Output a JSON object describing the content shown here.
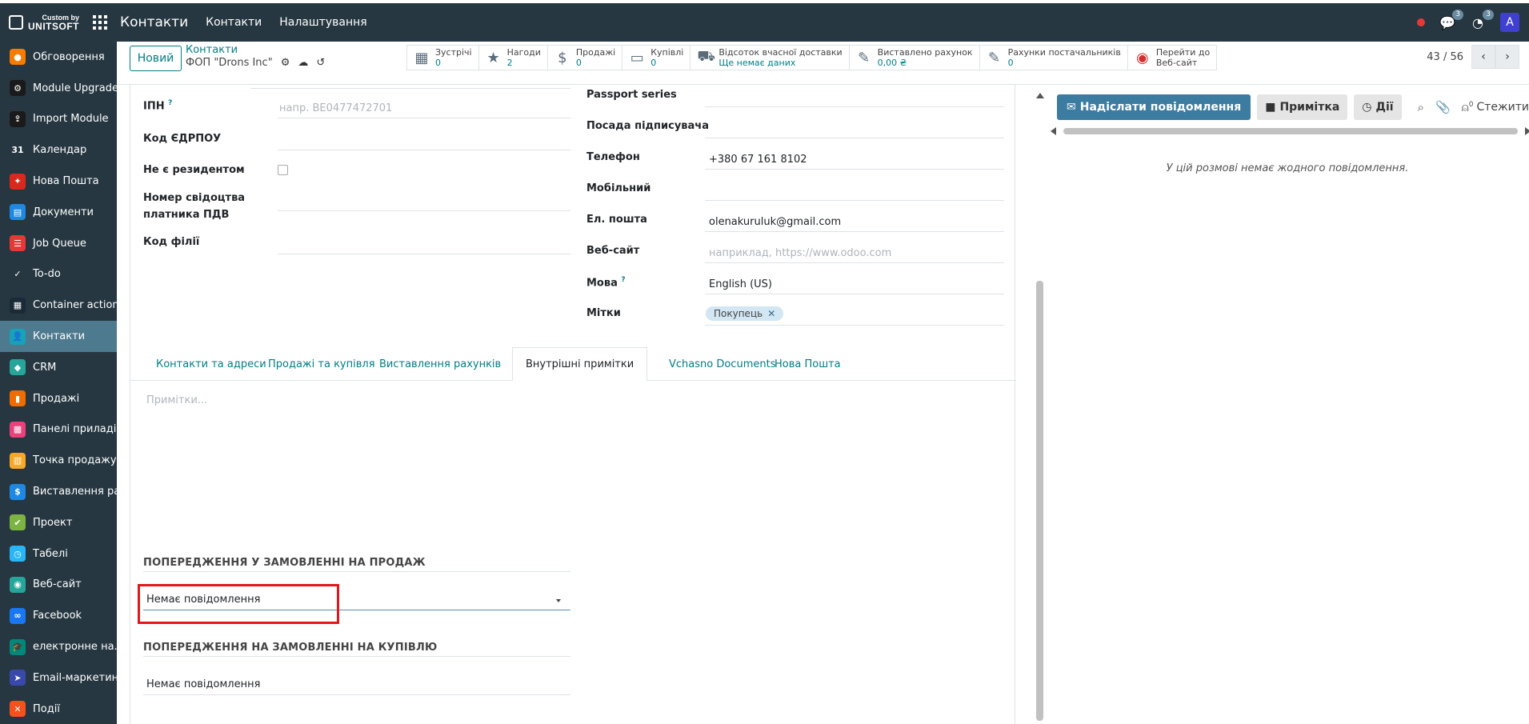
{
  "topbar": {
    "logo_line1": "Custom by",
    "logo_line2": "UNITSOFT",
    "brand": "Контакти",
    "menu": [
      "Контакти",
      "Налаштування"
    ],
    "chat_badge": "3",
    "activity_badge": "3",
    "avatar_letter": "A"
  },
  "sidebar": {
    "items": [
      {
        "label": "Обговорення",
        "icon": "discuss-icon",
        "color": "#f57c00",
        "glyph": "●"
      },
      {
        "label": "Module Upgrade",
        "icon": "module-upgrade-icon",
        "color": "#1a1a1a",
        "glyph": "⚙"
      },
      {
        "label": "Import Module",
        "icon": "import-module-icon",
        "color": "#1a1a1a",
        "glyph": "⇪"
      },
      {
        "label": "Календар",
        "icon": "calendar-icon",
        "color": "#263741",
        "glyph": "31"
      },
      {
        "label": "Нова Пошта",
        "icon": "nova-poshta-icon",
        "color": "#da291c",
        "glyph": "✦"
      },
      {
        "label": "Документи",
        "icon": "documents-icon",
        "color": "#1e88e5",
        "glyph": "▤"
      },
      {
        "label": "Job Queue",
        "icon": "job-queue-icon",
        "color": "#e53935",
        "glyph": "☰"
      },
      {
        "label": "To-do",
        "icon": "todo-icon",
        "color": "#263741",
        "glyph": "✓"
      },
      {
        "label": "Container actions",
        "icon": "container-actions-icon",
        "color": "#1a2a36",
        "glyph": "▦"
      },
      {
        "label": "Контакти",
        "icon": "contacts-icon",
        "color": "#17a2b8",
        "glyph": "👤"
      },
      {
        "label": "CRM",
        "icon": "crm-icon",
        "color": "#26a69a",
        "glyph": "◆"
      },
      {
        "label": "Продажі",
        "icon": "sales-icon",
        "color": "#ef6c00",
        "glyph": "▮"
      },
      {
        "label": "Панелі приладів",
        "icon": "dashboards-icon",
        "color": "#ec407a",
        "glyph": "▩"
      },
      {
        "label": "Точка продажу",
        "icon": "pos-icon",
        "color": "#f9a825",
        "glyph": "▥"
      },
      {
        "label": "Виставлення ра...",
        "icon": "invoicing-icon",
        "color": "#1e88e5",
        "glyph": "$"
      },
      {
        "label": "Проект",
        "icon": "project-icon",
        "color": "#7cb342",
        "glyph": "✔"
      },
      {
        "label": "Табелі",
        "icon": "timesheets-icon",
        "color": "#29b6f6",
        "glyph": "◷"
      },
      {
        "label": "Веб-сайт",
        "icon": "website-icon",
        "color": "#26a69a",
        "glyph": "◉"
      },
      {
        "label": "Facebook",
        "icon": "facebook-icon",
        "color": "#1877f2",
        "glyph": "∞"
      },
      {
        "label": "електронне на...",
        "icon": "elearning-icon",
        "color": "#00897b",
        "glyph": "🎓"
      },
      {
        "label": "Email-маркетинг",
        "icon": "email-marketing-icon",
        "color": "#3949ab",
        "glyph": "➤"
      },
      {
        "label": "Події",
        "icon": "events-icon",
        "color": "#f4511e",
        "glyph": "✕"
      }
    ],
    "active_index": 9
  },
  "control": {
    "new_button": "Новий",
    "breadcrumb_parent": "Контакти",
    "breadcrumb_current": "ФОП \"Drons Inc\"",
    "pager": "43 / 56",
    "smart_buttons": [
      {
        "label": "Зустрічі",
        "value": "0",
        "icon": "calendar-icon",
        "glyph": "▦"
      },
      {
        "label": "Нагоди",
        "value": "2",
        "icon": "star-icon",
        "glyph": "★"
      },
      {
        "label": "Продажі",
        "value": "0",
        "icon": "dollar-icon",
        "glyph": "$"
      },
      {
        "label": "Купівлі",
        "value": "0",
        "icon": "credit-card-icon",
        "glyph": "▭"
      },
      {
        "label": "Відсоток вчасної доставки",
        "value": "Ще немає даних",
        "icon": "truck-icon",
        "glyph": "⛟"
      },
      {
        "label": "Виставлено рахунок",
        "value": "0,00 ₴",
        "icon": "pencil-square-icon",
        "glyph": "✎"
      },
      {
        "label": "Рахунки постачальників",
        "value": "0",
        "icon": "pencil-square-icon",
        "glyph": "✎"
      },
      {
        "label": "Перейти до",
        "value": "Веб-сайт",
        "icon": "globe-icon",
        "glyph": "◉"
      }
    ]
  },
  "form": {
    "left": {
      "ipn_label": "ІПН",
      "ipn_tooltip": "?",
      "ipn_placeholder": "напр. BE0477472701",
      "edrpou_label": "Код ЄДРПОУ",
      "nonresident_label": "Не є резидентом",
      "vat_cert_label_1": "Номер свідоцтва",
      "vat_cert_label_2": "платника ПДВ",
      "branch_label": "Код філії"
    },
    "right": {
      "passport_label": "Passport series",
      "signer_label": "Посада підписувача",
      "phone_label": "Телефон",
      "phone_value": "+380 67 161 8102",
      "mobile_label": "Мобільний",
      "email_label": "Ел. пошта",
      "email_value": "olenakuruluk@gmail.com",
      "website_label": "Веб-сайт",
      "website_placeholder": "наприклад, https://www.odoo.com",
      "lang_label": "Мова",
      "lang_tooltip": "?",
      "lang_value": "English (US)",
      "tags_label": "Мітки",
      "tag_value": "Покупець"
    },
    "tabs": [
      "Контакти та адреси",
      "Продажі та купівля",
      "Виставлення рахунків",
      "Внутрішні примітки",
      "Vchasno Documents",
      "Нова Пошта"
    ],
    "active_tab_index": 3,
    "notes_placeholder": "Примітки...",
    "sale_warning_heading": "ПОПЕРЕДЖЕННЯ У ЗАМОВЛЕННІ НА ПРОДАЖ",
    "sale_warning_value": "Немає повідомлення",
    "purchase_warning_heading": "ПОПЕРЕДЖЕННЯ НА ЗАМОВЛЕННІ НА КУПІВЛЮ",
    "purchase_warning_value": "Немає повідомлення"
  },
  "chatter": {
    "send_button": "Надіслати повідомлення",
    "note_button": "Примітка",
    "actions_button": "Дії",
    "followers_count": "0",
    "follow_button": "Стежити",
    "empty_message": "У цій розмові немає жодного повідомлення."
  },
  "colors": {
    "navbar": "#263741",
    "accent": "#017e84",
    "sidebar_active": "#4d7a8e",
    "send_button": "#3c7ca1",
    "highlight_box": "#e4161b"
  }
}
